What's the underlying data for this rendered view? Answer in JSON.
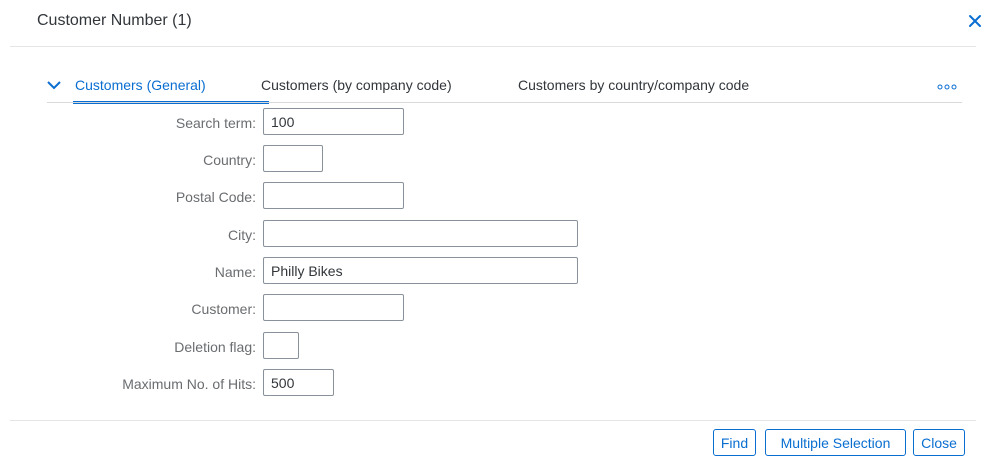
{
  "dialog": {
    "title": "Customer Number (1)",
    "close_icon": "close-icon"
  },
  "tabs": [
    {
      "label": "Customers (General)",
      "active": true
    },
    {
      "label": "Customers (by company code)",
      "active": false
    },
    {
      "label": "Customers by country/company code",
      "active": false
    }
  ],
  "fields": {
    "search_term": {
      "label": "Search term:",
      "value": "100"
    },
    "country": {
      "label": "Country:",
      "value": ""
    },
    "postal_code": {
      "label": "Postal Code:",
      "value": ""
    },
    "city": {
      "label": "City:",
      "value": ""
    },
    "name": {
      "label": "Name:",
      "value": "Philly Bikes"
    },
    "customer": {
      "label": "Customer:",
      "value": ""
    },
    "deletion_flag": {
      "label": "Deletion flag:",
      "value": ""
    },
    "max_hits": {
      "label": "Maximum No. of Hits:",
      "value": "500"
    }
  },
  "footer": {
    "find_label": "Find",
    "multiple_selection_label": "Multiple Selection",
    "close_label": "Close"
  },
  "colors": {
    "accent": "#0a6ed1",
    "text": "#32363a",
    "label": "#6a6d70",
    "border": "#89919a"
  }
}
